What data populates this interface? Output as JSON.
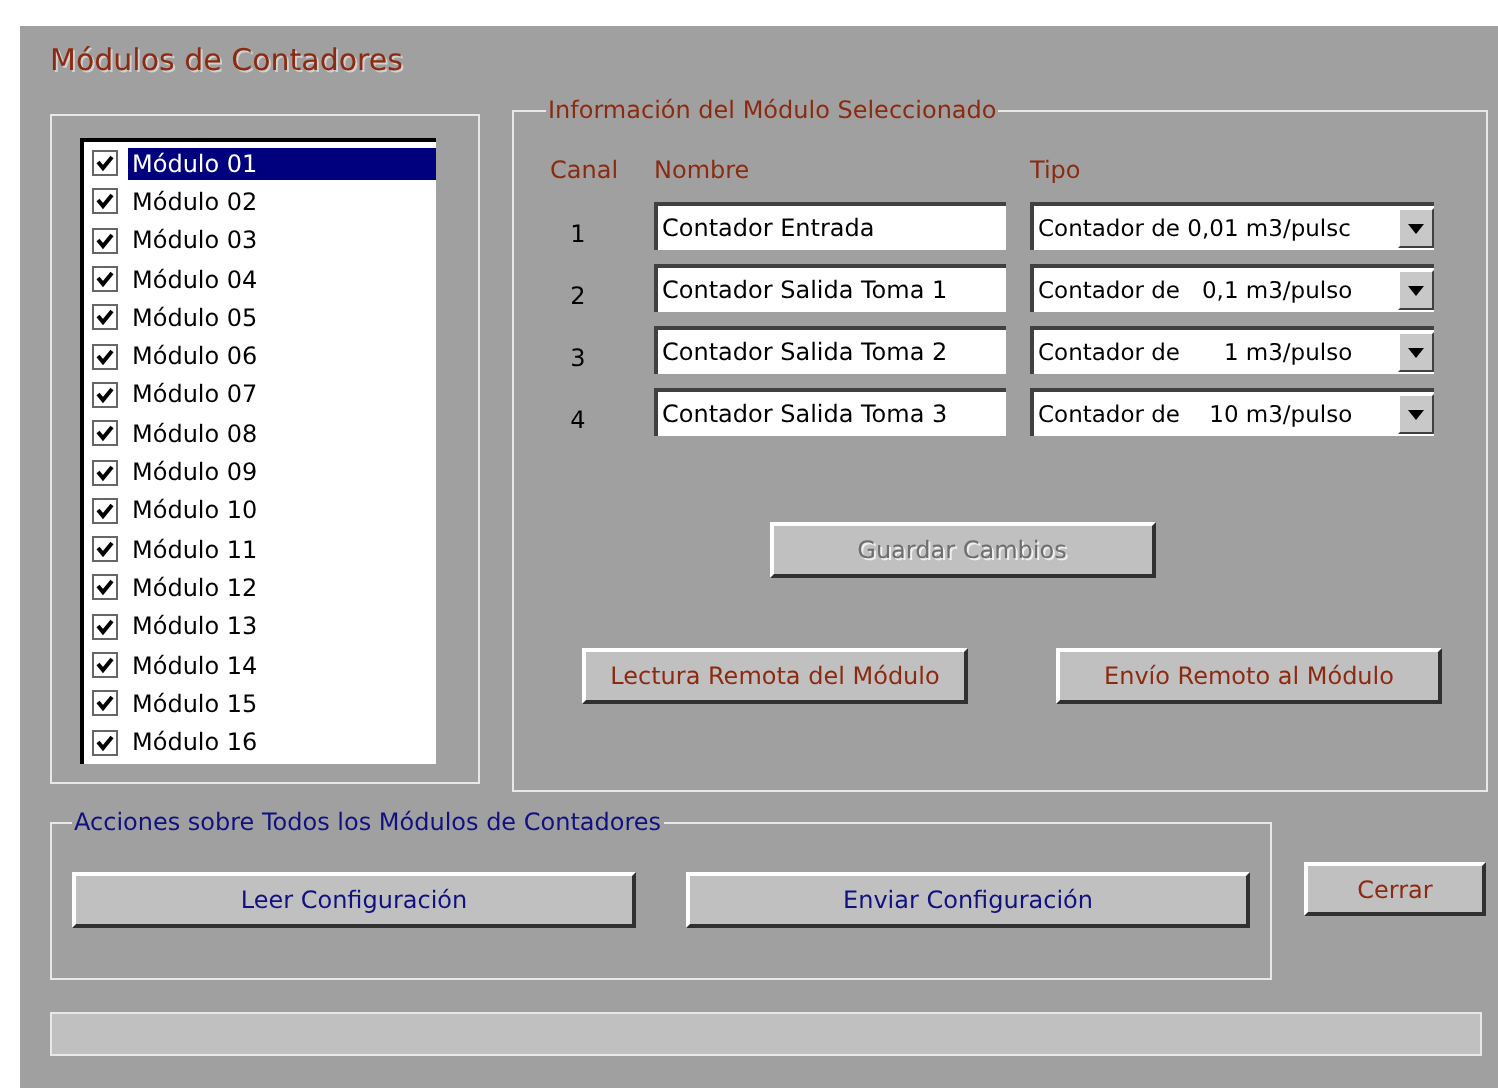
{
  "window": {
    "title": "Módulos de Contadores"
  },
  "modules": [
    {
      "label": "Módulo 01",
      "checked": true,
      "selected": true
    },
    {
      "label": "Módulo 02",
      "checked": true,
      "selected": false
    },
    {
      "label": "Módulo 03",
      "checked": true,
      "selected": false
    },
    {
      "label": "Módulo 04",
      "checked": true,
      "selected": false
    },
    {
      "label": "Módulo 05",
      "checked": true,
      "selected": false
    },
    {
      "label": "Módulo 06",
      "checked": true,
      "selected": false
    },
    {
      "label": "Módulo 07",
      "checked": true,
      "selected": false
    },
    {
      "label": "Módulo 08",
      "checked": true,
      "selected": false
    },
    {
      "label": "Módulo 09",
      "checked": true,
      "selected": false
    },
    {
      "label": "Módulo 10",
      "checked": true,
      "selected": false
    },
    {
      "label": "Módulo 11",
      "checked": true,
      "selected": false
    },
    {
      "label": "Módulo 12",
      "checked": true,
      "selected": false
    },
    {
      "label": "Módulo 13",
      "checked": true,
      "selected": false
    },
    {
      "label": "Módulo 14",
      "checked": true,
      "selected": false
    },
    {
      "label": "Módulo 15",
      "checked": true,
      "selected": false
    },
    {
      "label": "Módulo 16",
      "checked": true,
      "selected": false
    }
  ],
  "info": {
    "title": "Información del Módulo Seleccionado",
    "headers": [
      "Canal",
      "Nombre",
      "Tipo"
    ],
    "channels": [
      {
        "canal": "1",
        "nombre": "Contador Entrada",
        "tipo": "Contador de 0,01 m3/pulsc"
      },
      {
        "canal": "2",
        "nombre": "Contador Salida Toma 1",
        "tipo": "Contador de   0,1 m3/pulso"
      },
      {
        "canal": "3",
        "nombre": "Contador Salida Toma 2",
        "tipo": "Contador de      1 m3/pulso"
      },
      {
        "canal": "4",
        "nombre": "Contador Salida Toma 3",
        "tipo": "Contador de    10 m3/pulso"
      }
    ],
    "save_button": {
      "label": "Guardar Cambios",
      "disabled": true
    },
    "buttons": [
      "Lectura Remota del Módulo",
      "Envío Remoto al Módulo"
    ]
  },
  "all_actions": {
    "title": "Acciones sobre Todos los Módulos de Contadores",
    "buttons": [
      "Leer Configuración",
      "Enviar Configuración"
    ]
  },
  "close_button": "Cerrar"
}
